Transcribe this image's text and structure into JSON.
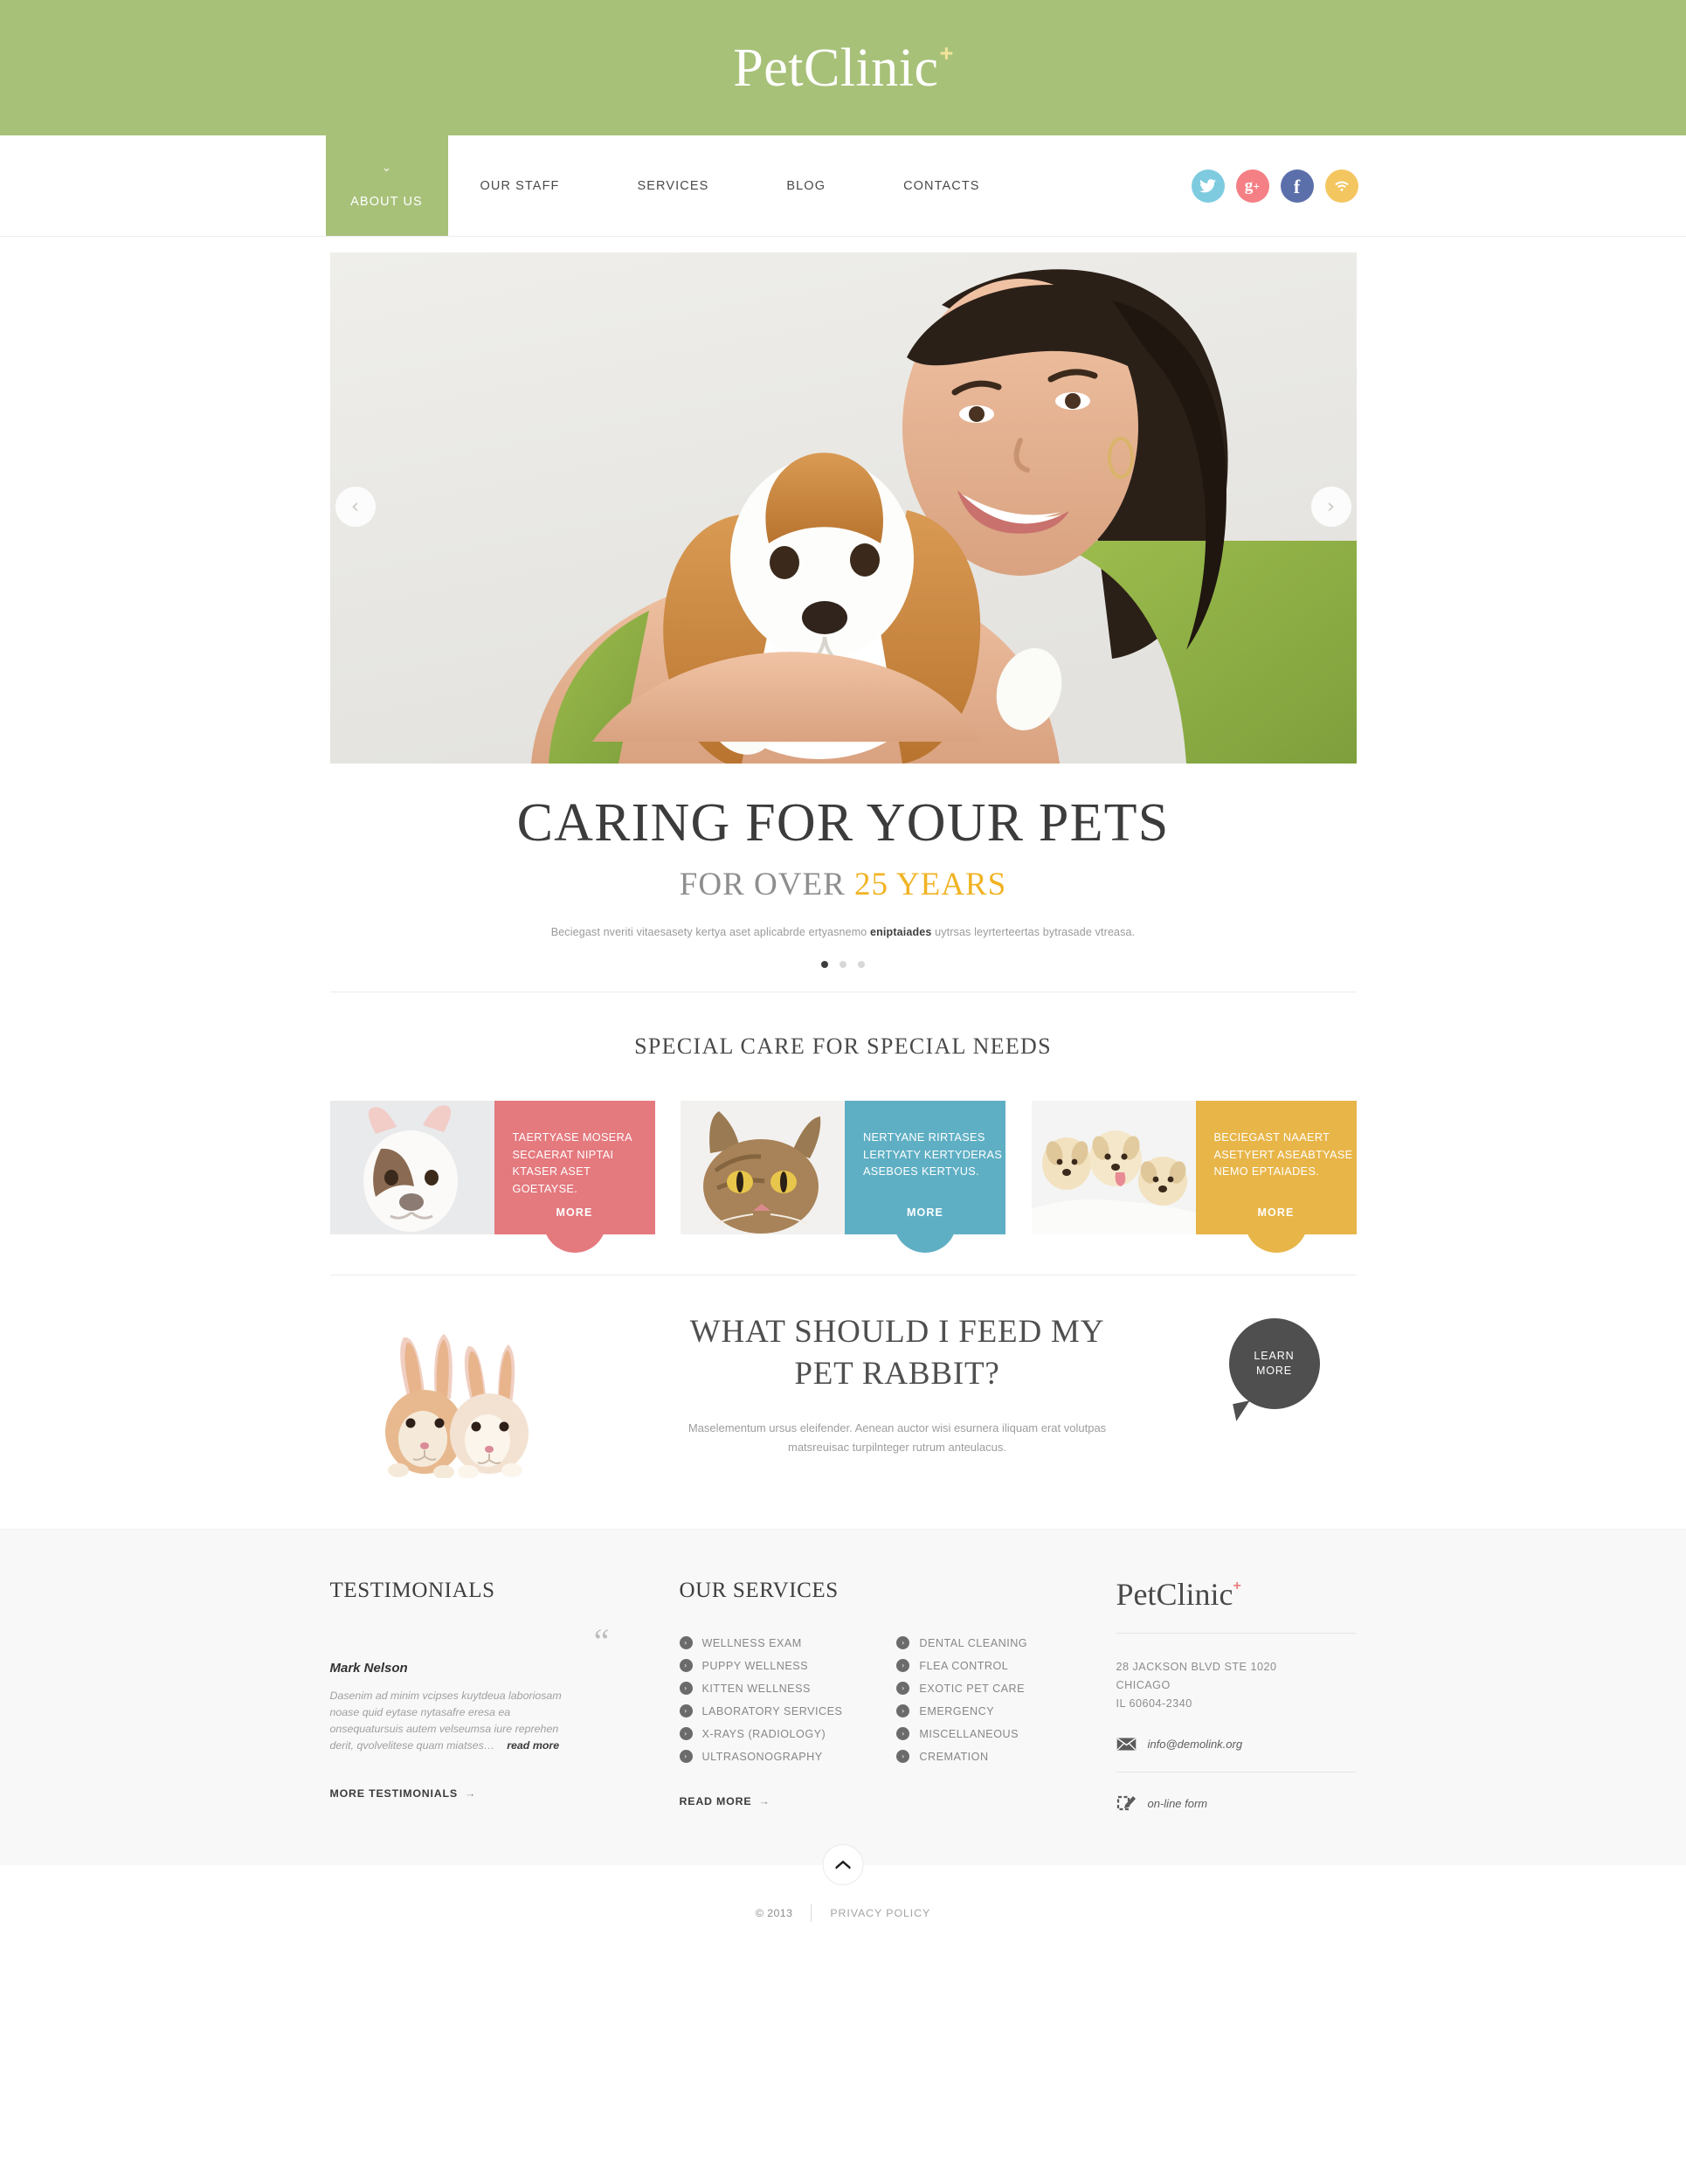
{
  "brand": {
    "name": "PetClinic",
    "plus": "+"
  },
  "nav": {
    "active": {
      "label": "ABOUT US",
      "caret": "chevron-down-icon"
    },
    "items": [
      {
        "label": "OUR STAFF"
      },
      {
        "label": "SERVICES"
      },
      {
        "label": "BLOG"
      },
      {
        "label": "CONTACTS"
      }
    ],
    "socials": [
      {
        "name": "twitter-icon",
        "color": "#7ecbe0"
      },
      {
        "name": "google-plus-icon",
        "color": "#f47f84"
      },
      {
        "name": "facebook-icon",
        "color": "#5b6fab"
      },
      {
        "name": "rss-icon",
        "color": "#f3c660"
      }
    ]
  },
  "hero": {
    "prev": "‹",
    "next": "›",
    "title": "CARING FOR YOUR PETS",
    "subtitle_prefix": "FOR OVER ",
    "subtitle_highlight": "25 YEARS",
    "desc_before": "Beciegast nveriti vitaesasety kertya aset aplicabrde ertyasnemo ",
    "desc_bold": "eniptaiades",
    "desc_after": " uytrsas leyrterteertas bytrasade vtreasa.",
    "slides": 3,
    "active_slide": 1,
    "highlight_color": "#f0b323"
  },
  "special": {
    "title": "SPECIAL CARE FOR SPECIAL NEEDS",
    "cards": [
      {
        "image": "french-bulldog-photo",
        "text": "TAERTYASE MOSERA SECAERAT NIPTAI KTASER ASET GOETAYSE.",
        "more": "MORE",
        "color": "#e4797e"
      },
      {
        "image": "tabby-cat-photo",
        "text": "NERTYANE RIRTASES LERTYATY KERTYDERAS ASEBOES KERTYUS.",
        "more": "MORE",
        "color": "#5fafc4"
      },
      {
        "image": "labrador-puppies-photo",
        "text": "BECIEGAST NAAERT ASETYERT ASEABTYASE NEMO EPTAIADES.",
        "more": "MORE",
        "color": "#e8b548"
      }
    ]
  },
  "rabbit": {
    "image": "two-rabbits-photo",
    "title_line1": "WHAT SHOULD I FEED MY",
    "title_line2": "PET RABBIT?",
    "text_line1": "Maselementum ursus eleifender. Aenean auctor wisi esurnera iliquam erat volutpas",
    "text_line2": "matsreuisac turpilnteger rutrum anteulacus.",
    "bubble_line1": "LEARN",
    "bubble_line2": "MORE"
  },
  "footer": {
    "testimonials": {
      "heading": "TESTIMONIALS",
      "quote_icon": "“",
      "author": "Mark Nelson",
      "body": "Dasenim ad minim vcipses kuytdeua laboriosam noase quid eytase nytasafre eresa ea onsequatursuis autem velseumsa iure reprehen derit, qvolvelitese quam miatses…",
      "read_more": "read more",
      "link": "MORE TESTIMONIALS",
      "link_arrow": "→"
    },
    "services": {
      "heading": "OUR SERVICES",
      "col1": [
        "WELLNESS EXAM",
        "PUPPY WELLNESS",
        "KITTEN WELLNESS",
        "LABORATORY SERVICES",
        "X-RAYS (RADIOLOGY)",
        "ULTRASONOGRAPHY"
      ],
      "col2": [
        "DENTAL CLEANING",
        "FLEA CONTROL",
        "EXOTIC PET CARE",
        "EMERGENCY",
        "MISCELLANEOUS",
        "CREMATION"
      ],
      "bullet": "›",
      "link": "READ MORE",
      "link_arrow": "→"
    },
    "contact": {
      "logo": "PetClinic",
      "logo_plus": "+",
      "address_line1": "28 JACKSON BLVD STE 1020",
      "address_line2": "CHICAGO",
      "address_line3": "IL 60604-2340",
      "email": "info@demolink.org",
      "email_icon": "envelope-icon",
      "form_label": "on-line form",
      "form_icon": "form-pencil-icon"
    },
    "to_top": "^"
  },
  "copyright": {
    "text": "© 2013",
    "privacy": "PRIVACY POLICY"
  }
}
